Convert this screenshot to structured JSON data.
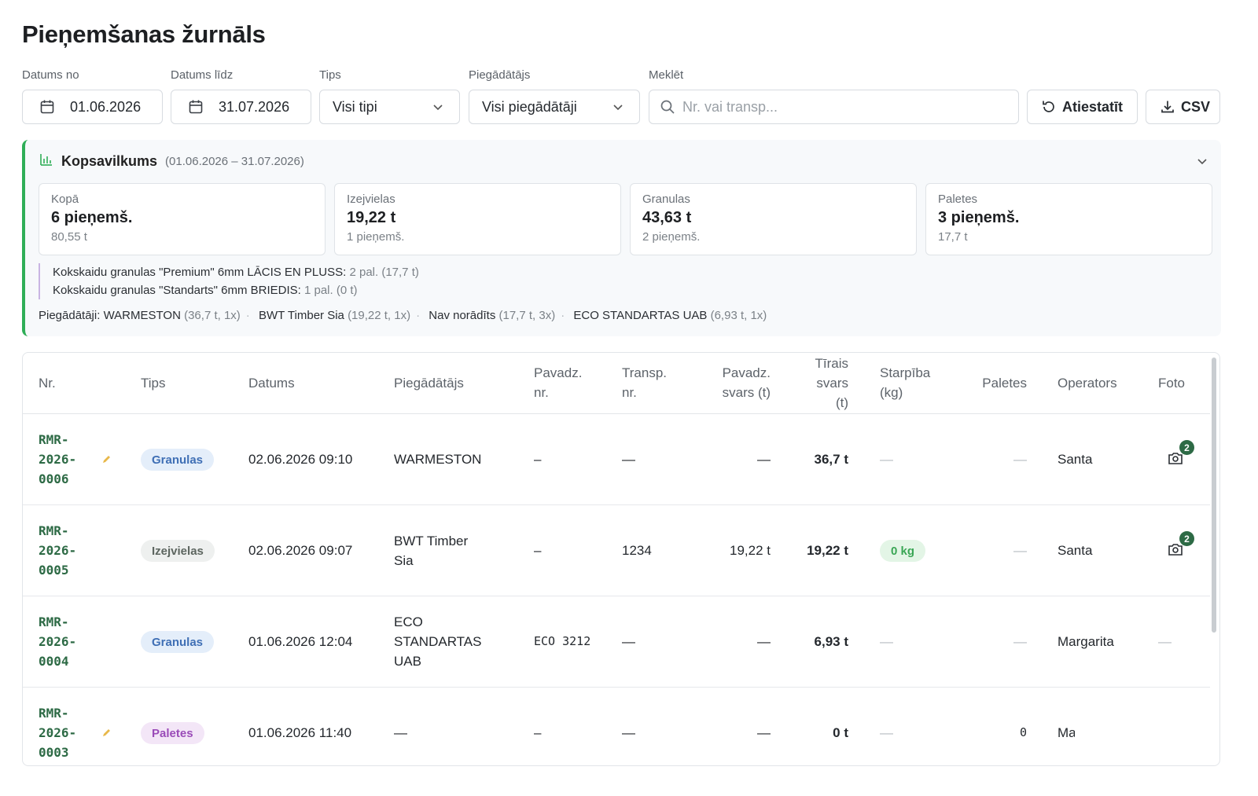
{
  "page": {
    "title": "Pieņemšanas žurnāls"
  },
  "filters": {
    "date_from": {
      "label": "Datums no",
      "value": "01.06.2026",
      "icon": "calendar-icon"
    },
    "date_to": {
      "label": "Datums līdz",
      "value": "31.07.2026",
      "icon": "calendar-icon"
    },
    "type": {
      "label": "Tips",
      "value": "Visi tipi"
    },
    "supplier": {
      "label": "Piegādātājs",
      "value": "Visi piegādātāji"
    },
    "search": {
      "label": "Meklēt",
      "placeholder": "Nr. vai transp..."
    },
    "reset_label": "Atiestatīt",
    "csv_label": "CSV"
  },
  "summary": {
    "title": "Kopsavilkums",
    "range": "(01.06.2026 – 31.07.2026)",
    "accent": "#2fae57",
    "cards": [
      {
        "label": "Kopā",
        "value": "6 pieņemš.",
        "sub": "80,55 t"
      },
      {
        "label": "Izejvielas",
        "value": "19,22 t",
        "sub": "1 pieņemš."
      },
      {
        "label": "Granulas",
        "value": "43,63 t",
        "sub": "2 pieņemš."
      },
      {
        "label": "Paletes",
        "value": "3 pieņemš.",
        "sub": "17,7 t"
      }
    ],
    "pallets": [
      {
        "name": "Kokskaidu granulas \"Premium\" 6mm LĀCIS EN PLUSS:",
        "detail": "2 pal. (17,7 t)"
      },
      {
        "name": "Kokskaidu granulas \"Standarts\" 6mm BRIEDIS:",
        "detail": "1 pal. (0 t)"
      }
    ],
    "suppliers_label": "Piegādātāji:",
    "suppliers": [
      {
        "name": "WARMESTON",
        "detail": "(36,7 t, 1x)"
      },
      {
        "name": "BWT Timber Sia",
        "detail": "(19,22 t, 1x)"
      },
      {
        "name": "Nav norādīts",
        "detail": "(17,7 t, 3x)"
      },
      {
        "name": "ECO STANDARTAS UAB",
        "detail": "(6,93 t, 1x)"
      }
    ]
  },
  "table": {
    "headers": {
      "nr": "Nr.",
      "tips": "Tips",
      "datums": "Datums",
      "piegadatajs": "Piegādātājs",
      "pavadz_nr_1": "Pavadz.",
      "pavadz_nr_2": "nr.",
      "transp_1": "Transp.",
      "transp_2": "nr.",
      "pavadz_svars_1": "Pavadz.",
      "pavadz_svars_2": "svars (t)",
      "tirais_1": "Tīrais",
      "tirais_2": "svars",
      "tirais_3": "(t)",
      "starpiba_1": "Starpība",
      "starpiba_2": "(kg)",
      "paletes": "Paletes",
      "operators": "Operators",
      "foto": "Foto"
    },
    "rows": [
      {
        "nr": [
          "RMR-",
          "2026-",
          "0006"
        ],
        "tips": "Granulas",
        "datums": "02.06.2026 09:10",
        "supplier": [
          "WARMESTON"
        ],
        "pavadz_nr": "–",
        "transp": "—",
        "pavadz_svars": "—",
        "tirais": "36,7 t",
        "starpiba": "—",
        "paletes": "—",
        "operators": "Santa",
        "foto": "2"
      },
      {
        "nr": [
          "RMR-",
          "2026-",
          "0005"
        ],
        "tips": "Izejvielas",
        "datums": "02.06.2026 09:07",
        "supplier": [
          "BWT Timber",
          "Sia"
        ],
        "pavadz_nr": "–",
        "transp": "1234",
        "pavadz_svars": "19,22 t",
        "tirais": "19,22 t",
        "starpiba": "0 kg",
        "paletes": "—",
        "operators": "Santa",
        "foto": "2"
      },
      {
        "nr": [
          "RMR-",
          "2026-",
          "0004"
        ],
        "tips": "Granulas",
        "datums": "01.06.2026 12:04",
        "supplier": [
          "ECO",
          "STANDARTAS",
          "UAB"
        ],
        "pavadz_nr": "ECO 3212",
        "transp": "—",
        "pavadz_svars": "—",
        "tirais": "6,93 t",
        "starpiba": "—",
        "paletes": "—",
        "operators": "Margarita",
        "foto": "—"
      },
      {
        "nr": [
          "RMR-",
          "2026-",
          "0003"
        ],
        "tips": "Paletes",
        "datums": "01.06.2026 11:40",
        "supplier": [
          "—"
        ],
        "pavadz_nr": "–",
        "transp": "—",
        "pavadz_svars": "—",
        "tirais": "0 t",
        "starpiba": "—",
        "paletes": "0",
        "operators": "Ma",
        "foto": ""
      }
    ]
  }
}
